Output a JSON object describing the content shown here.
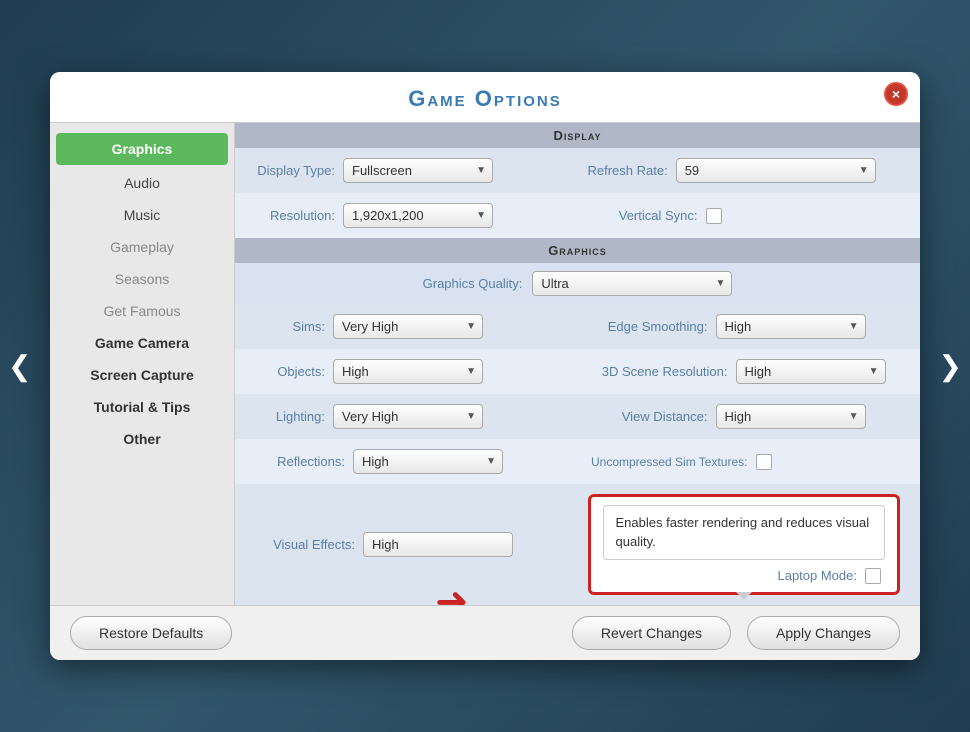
{
  "background": {
    "color": "#4a7fa5"
  },
  "modal": {
    "title": "Game Options",
    "close_label": "×"
  },
  "nav": {
    "left_arrow": "❮",
    "right_arrow": "❯"
  },
  "sidebar": {
    "items": [
      {
        "id": "graphics",
        "label": "Graphics",
        "state": "active"
      },
      {
        "id": "audio",
        "label": "Audio",
        "state": "normal"
      },
      {
        "id": "music",
        "label": "Music",
        "state": "normal"
      },
      {
        "id": "gameplay",
        "label": "Gameplay",
        "state": "muted"
      },
      {
        "id": "seasons",
        "label": "Seasons",
        "state": "muted"
      },
      {
        "id": "get-famous",
        "label": "Get Famous",
        "state": "muted"
      },
      {
        "id": "game-camera",
        "label": "Game Camera",
        "state": "bold"
      },
      {
        "id": "screen-capture",
        "label": "Screen Capture",
        "state": "bold"
      },
      {
        "id": "tutorial-tips",
        "label": "Tutorial & Tips",
        "state": "bold"
      },
      {
        "id": "other",
        "label": "Other",
        "state": "bold"
      }
    ]
  },
  "sections": {
    "display": {
      "header": "Display",
      "display_type_label": "Display Type:",
      "display_type_value": "Fullscreen",
      "refresh_rate_label": "Refresh Rate:",
      "refresh_rate_value": "59",
      "resolution_label": "Resolution:",
      "resolution_value": "1,920x1,200",
      "vertical_sync_label": "Vertical Sync:"
    },
    "graphics": {
      "header": "Graphics",
      "quality_label": "Graphics Quality:",
      "quality_value": "Ultra",
      "sims_label": "Sims:",
      "sims_value": "Very High",
      "edge_smoothing_label": "Edge Smoothing:",
      "edge_smoothing_value": "High",
      "objects_label": "Objects:",
      "objects_value": "High",
      "scene_resolution_label": "3D Scene Resolution:",
      "scene_resolution_value": "High",
      "lighting_label": "Lighting:",
      "lighting_value": "Very High",
      "view_distance_label": "View Distance:",
      "view_distance_value": "High",
      "reflections_label": "Reflections:",
      "reflections_value": "High",
      "uncompressed_label": "Uncompressed Sim Textures:",
      "visual_effects_label": "Visual Effects:",
      "visual_effects_value": "High",
      "laptop_mode_label": "Laptop Mode:"
    }
  },
  "tooltip": {
    "text": "Enables faster rendering and reduces visual quality."
  },
  "footer": {
    "restore_defaults": "Restore Defaults",
    "revert_changes": "Revert Changes",
    "apply_changes": "Apply Changes"
  }
}
